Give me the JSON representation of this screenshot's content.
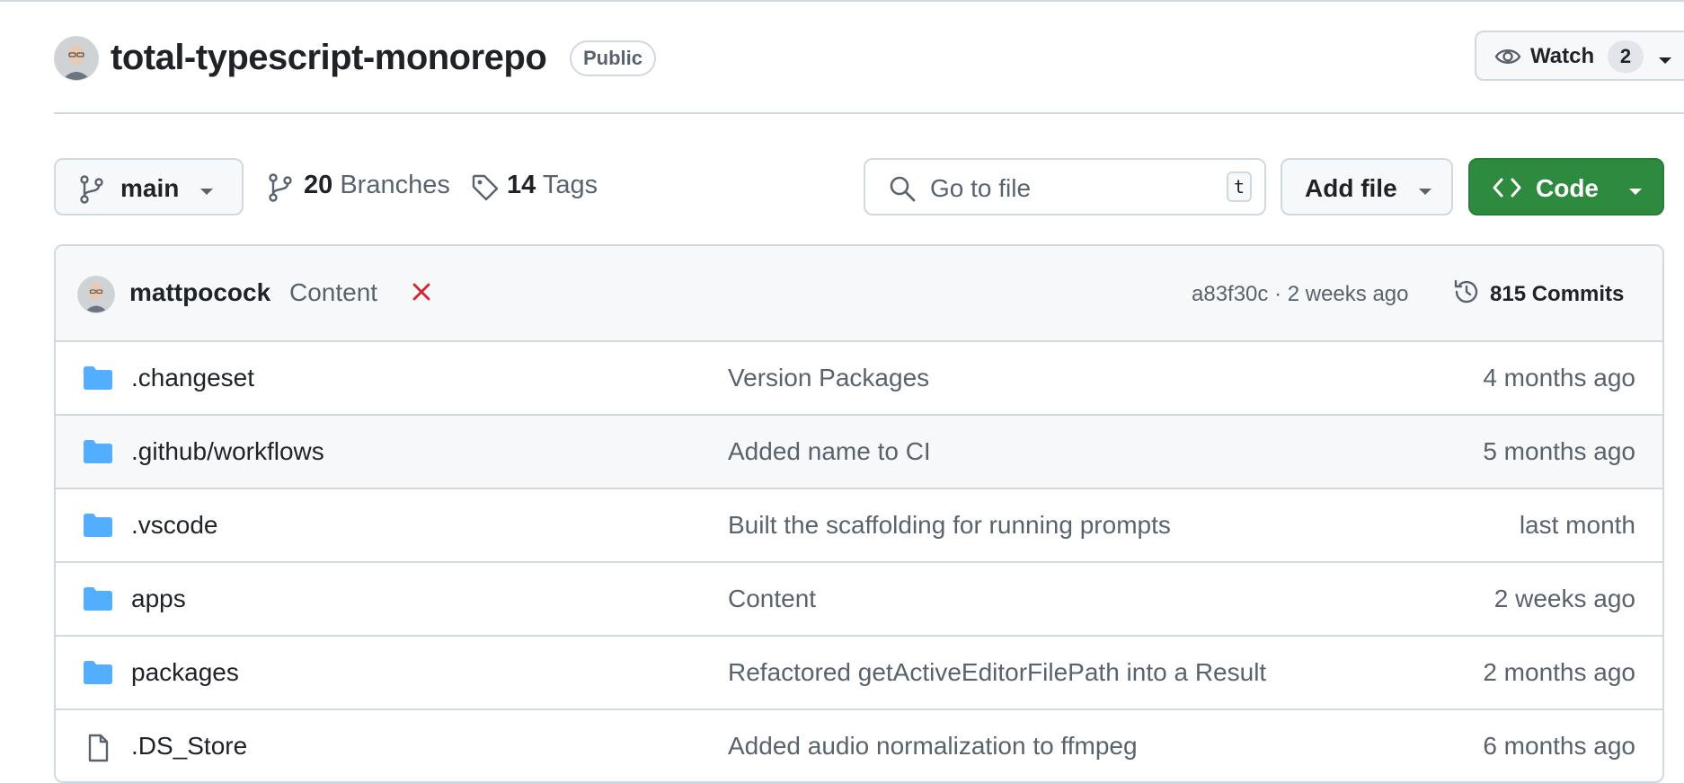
{
  "repo": {
    "name": "total-typescript-monorepo",
    "visibility": "Public"
  },
  "watch": {
    "label": "Watch",
    "count": "2"
  },
  "toolbar": {
    "branch": "main",
    "branches_count": "20",
    "branches_label": "Branches",
    "tags_count": "14",
    "tags_label": "Tags",
    "search_placeholder": "Go to file",
    "search_shortcut": "t",
    "add_file_label": "Add file",
    "code_label": "Code"
  },
  "latest_commit": {
    "author": "mattpocock",
    "message": "Content",
    "status": "failed",
    "sha_age": "a83f30c · 2 weeks ago",
    "commits": "815 Commits"
  },
  "files": [
    {
      "type": "folder",
      "name": ".changeset",
      "message": "Version Packages",
      "age": "4 months ago"
    },
    {
      "type": "folder",
      "name": ".github/workflows",
      "message": "Added name to CI",
      "age": "5 months ago"
    },
    {
      "type": "folder",
      "name": ".vscode",
      "message": "Built the scaffolding for running prompts",
      "age": "last month"
    },
    {
      "type": "folder",
      "name": "apps",
      "message": "Content",
      "age": "2 weeks ago"
    },
    {
      "type": "folder",
      "name": "packages",
      "message": "Refactored getActiveEditorFilePath into a Result",
      "age": "2 months ago"
    },
    {
      "type": "file",
      "name": ".DS_Store",
      "message": "Added audio normalization to ffmpeg",
      "age": "6 months ago"
    }
  ],
  "colors": {
    "code_button": "#2e8a3e",
    "folder_icon": "#54aeff",
    "failure": "#d1242f",
    "muted_text": "#59636e"
  },
  "icons": {
    "repo_avatar": "user-avatar",
    "watch": "eye-icon",
    "branch": "git-branch-icon",
    "tags": "tag-icon",
    "search": "search-icon",
    "code": "code-icon",
    "status": "x-icon",
    "history": "history-icon",
    "folder": "folder-icon",
    "file": "file-icon"
  }
}
